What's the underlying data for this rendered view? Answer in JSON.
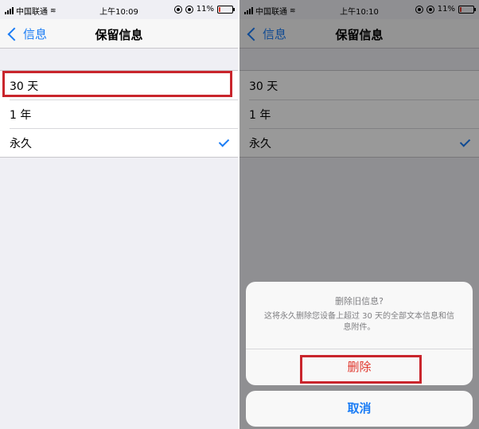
{
  "status_left": {
    "carrier": "中国联通",
    "time": "上午10:09",
    "battery": "11%"
  },
  "status_right": {
    "carrier": "中国联通",
    "time": "上午10:10",
    "battery": "11%"
  },
  "nav": {
    "back_label": "信息",
    "title": "保留信息"
  },
  "options": [
    "30 天",
    "1 年",
    "永久"
  ],
  "selected_option": "永久",
  "action_sheet": {
    "title": "删除旧信息?",
    "message": "这将永久删除您设备上超过 30 天的全部文本信息和信息附件。",
    "delete_label": "删除",
    "cancel_label": "取消"
  },
  "colors": {
    "accent": "#1a7cf5",
    "destructive": "#e0362c",
    "annotation": "#c9252c"
  }
}
